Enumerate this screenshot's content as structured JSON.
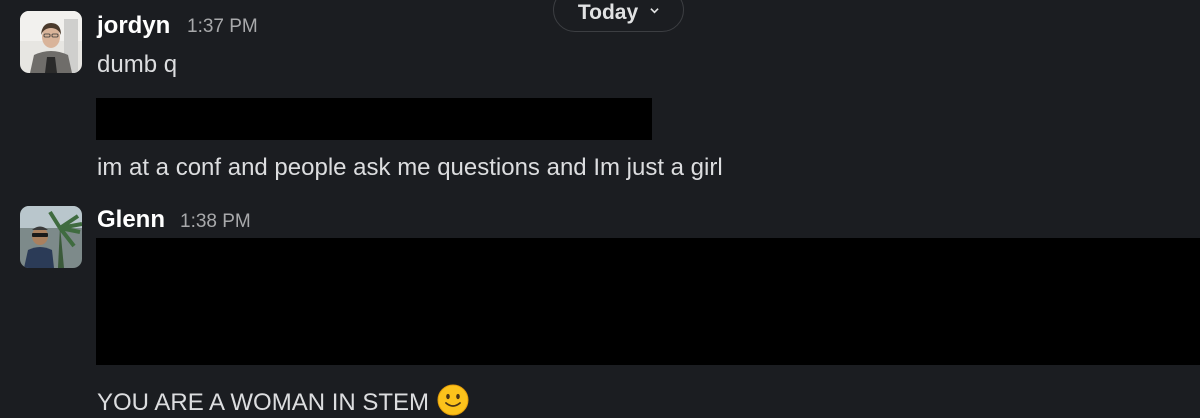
{
  "date_divider": {
    "label": "Today",
    "icon": "chevron-down-icon"
  },
  "messages": [
    {
      "author": "jordyn",
      "time": "1:37 PM",
      "lines": [
        "dumb q",
        "im at a conf and people ask me questions and Im just a girl"
      ],
      "avatar": "avatar-jordyn"
    },
    {
      "author": "Glenn",
      "time": "1:38 PM",
      "lines": [
        "YOU ARE A WOMAN IN STEM"
      ],
      "emoji": "slightly-smiling-face-icon",
      "avatar": "avatar-glenn"
    }
  ],
  "colors": {
    "background": "#1b1d21",
    "redaction": "#000000",
    "author": "#ffffff",
    "timestamp": "#a8a9ab",
    "text": "#dcdddf"
  }
}
